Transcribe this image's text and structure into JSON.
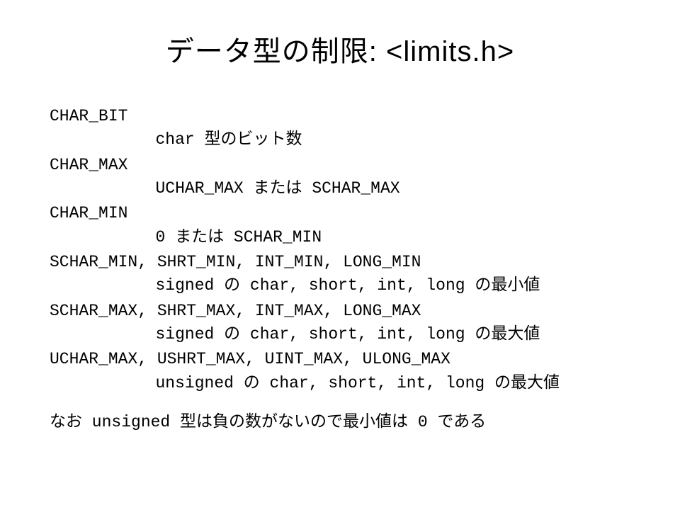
{
  "title": "データ型の制限: <limits.h>",
  "items": [
    {
      "term": "CHAR_BIT",
      "desc": "char 型のビット数"
    },
    {
      "term": "CHAR_MAX",
      "desc": "UCHAR_MAX または SCHAR_MAX"
    },
    {
      "term": "CHAR_MIN",
      "desc": "0 または SCHAR_MIN"
    },
    {
      "term": "SCHAR_MIN, SHRT_MIN, INT_MIN, LONG_MIN",
      "desc": "signed の char, short, int, long の最小値"
    },
    {
      "term": "SCHAR_MAX, SHRT_MAX, INT_MAX, LONG_MAX",
      "desc": "signed の char, short, int, long の最大値"
    },
    {
      "term": "UCHAR_MAX, USHRT_MAX, UINT_MAX, ULONG_MAX",
      "desc": "unsigned の char, short, int, long の最大値"
    }
  ],
  "note": "なお unsigned 型は負の数がないので最小値は 0 である"
}
